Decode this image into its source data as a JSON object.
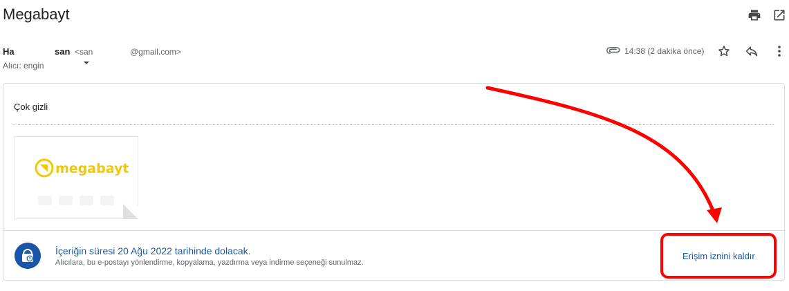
{
  "email": {
    "subject": "Megabayt",
    "sender_name_1": "Ha",
    "sender_name_2": "san",
    "sender_email_1": "<san",
    "sender_email_2": "@gmail.com>",
    "recipient": "Alıcı: engin",
    "time": "14:38 (2 dakika önce)",
    "body": "Çok gizli",
    "attachment_logo_text": "megabayt"
  },
  "confidential": {
    "title": "İçeriğin süresi 20 Ağu 2022 tarihinde dolacak.",
    "subtitle": "Alıcılara, bu e-postayı yönlendirme, kopyalama, yazdırma veya indirme seçeneği sunulmaz.",
    "revoke_label": "Erişim iznini kaldır"
  },
  "colors": {
    "accent": "#1a5aa6",
    "logo_yellow": "#f0c808",
    "annotation_red": "#ff0000"
  },
  "icons": [
    "print-icon",
    "open-in-new-icon",
    "attachment-icon",
    "star-icon",
    "reply-icon",
    "more-vert-icon",
    "chevron-down-icon",
    "clock-lock-icon"
  ]
}
